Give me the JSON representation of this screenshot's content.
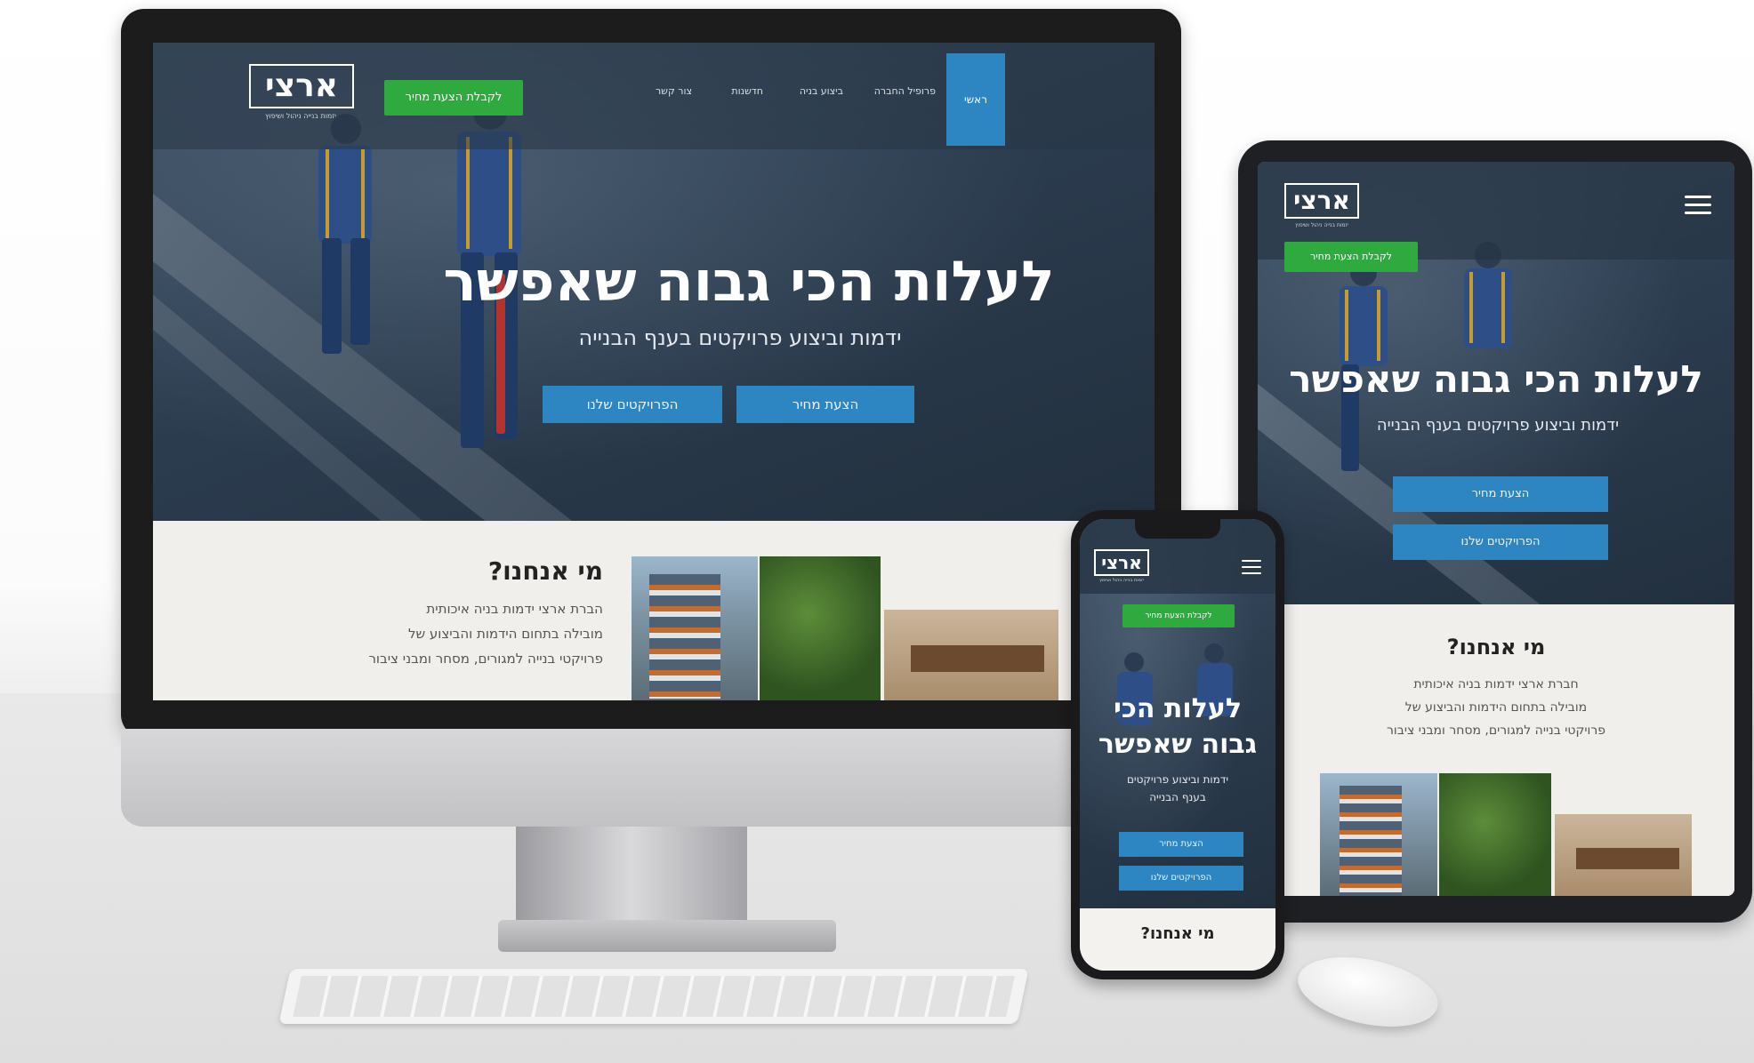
{
  "brand": {
    "logo_text": "ארצי",
    "tagline": "יזמות בנייה ניהול ושיפוץ"
  },
  "nav": {
    "items": [
      "ראשי",
      "פרופיל החברה",
      "ביצוע בניה",
      "חדשנות",
      "צור קשר"
    ],
    "active_index": 0,
    "cta_label": "לקבלת הצעת מחיר"
  },
  "hero": {
    "title": "לעלות הכי גבוה שאפשר",
    "subtitle": "ידמות וביצוע פרויקטים בענף הבנייה",
    "primary_button": "הצעת מחיר",
    "secondary_button": "הפרויקטים שלנו"
  },
  "about": {
    "title": "מי אנחנו?",
    "lines": [
      "הברת ארצי ידמות בניה איכותית",
      "מובילה בתחום הידמות והביצוע של",
      "פרויקטי בנייה למגורים, מסחר ומבני ציבור"
    ]
  },
  "tablet": {
    "cta_label": "לקבלת הצעת מחיר",
    "subtitle": "ידמות וביצוע פרויקטים בענף הבנייה",
    "primary_button": "הצעת מחיר",
    "secondary_button": "הפרויקטים שלנו",
    "about_title": "מי אנחנו?",
    "about_lines": [
      "חברת ארצי ידמות בניה איכותית",
      "מובילה בתחום הידמות והביצוע של",
      "פרויקטי בנייה למגורים, מסחר ומבני ציבור"
    ]
  },
  "phone": {
    "cta_label": "לקבלת הצעת מחיר",
    "title_line1": "לעלות הכי",
    "title_line2": "גבוה שאפשר",
    "subtitle_line1": "ידמות וביצוע פרויקטים",
    "subtitle_line2": "בענף הבנייה",
    "primary_button": "הצעת מחיר",
    "secondary_button": "הפרויקטים שלנו",
    "about_title": "מי אנחנו?"
  },
  "colors": {
    "nav_bg": "#2b3a4a",
    "accent_blue": "#2d86c1",
    "cta_green": "#2eaa3f",
    "about_bg": "#f1efec"
  },
  "icons": {
    "menu": "hamburger-menu-icon"
  }
}
